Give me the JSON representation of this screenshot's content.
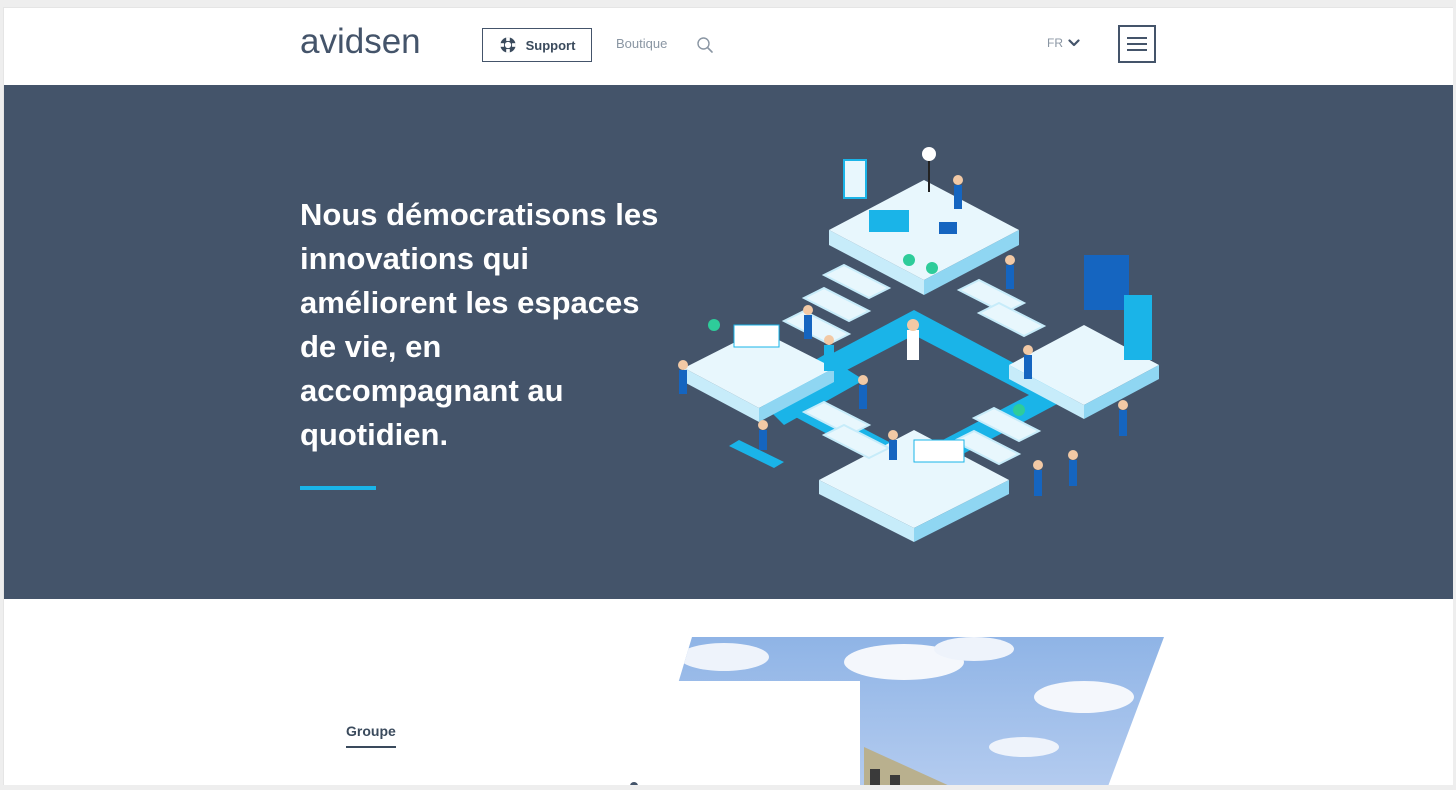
{
  "header": {
    "logo_text": "avidsen",
    "support_label": "Support",
    "boutique_label": "Boutique",
    "lang_label": "FR",
    "icons": [
      "lifebuoy-icon",
      "search-icon",
      "chevron-down-icon",
      "hamburger-menu-icon"
    ]
  },
  "hero": {
    "title": "Nous démocratisons les innovations qui améliorent les espaces de vie, en accompagnant au quotidien."
  },
  "section2": {
    "tab_label": "Groupe"
  },
  "colors": {
    "brand_dark": "#44546a",
    "accent": "#1ab4e8",
    "muted_text": "#8a96a3"
  }
}
